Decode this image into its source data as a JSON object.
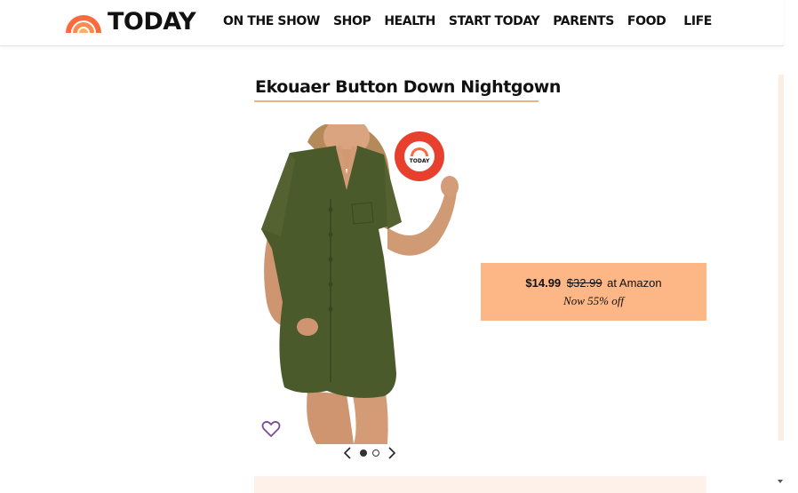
{
  "header": {
    "logo_text": "TODAY",
    "nav": [
      "ON THE SHOW",
      "SHOP",
      "HEALTH",
      "START TODAY",
      "PARENTS",
      "FOOD",
      "LIFE"
    ]
  },
  "product": {
    "title": "Ekouaer Button Down Nightgown",
    "badge_text": "TODAY",
    "badge_icon": "shop-today-sleep-award-badge",
    "image_icon": "green-nightgown-photo"
  },
  "price": {
    "current": "$14.99",
    "original": "$32.99",
    "store": "at Amazon",
    "discount": "Now 55% off"
  },
  "carousel": {
    "total_slides": 2,
    "active_slide": 1
  },
  "colors": {
    "brand_orange": "#fa6a3c",
    "price_box": "#fdb686",
    "underline": "#e8b47f",
    "heart": "#7a4c9b",
    "garment": "#4b5a2a"
  }
}
